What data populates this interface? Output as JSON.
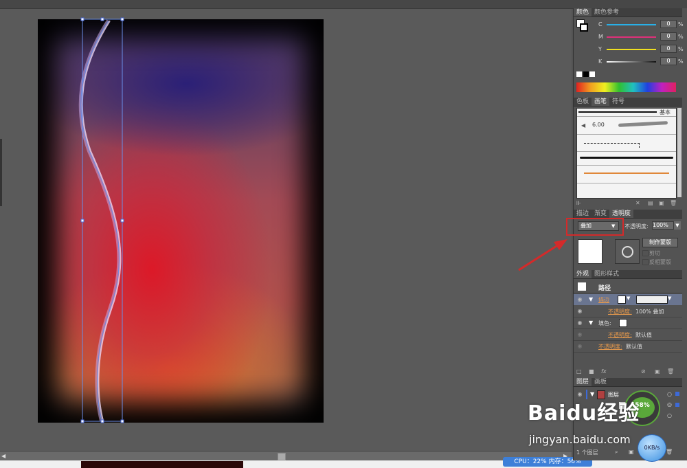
{
  "panels": {
    "color": {
      "tabs": [
        "颜色",
        "颜色参考"
      ],
      "channels": [
        {
          "letter": "C",
          "value": "0",
          "unit": "%",
          "color": "#28b0e8"
        },
        {
          "letter": "M",
          "value": "0",
          "unit": "%",
          "color": "#e0307a"
        },
        {
          "letter": "Y",
          "value": "0",
          "unit": "%",
          "color": "#f0e020"
        },
        {
          "letter": "K",
          "value": "0",
          "unit": "%",
          "color": "#222222"
        }
      ]
    },
    "brush": {
      "tabs": [
        "色板",
        "画笔",
        "符号"
      ],
      "basic_label": "基本",
      "size_value": "6.00"
    },
    "transparency": {
      "tabs": [
        "描边",
        "渐变",
        "透明度"
      ],
      "blend_mode": "叠加",
      "opacity_label": "不透明度:",
      "opacity_value": "100%",
      "make_mask_button": "制作蒙版",
      "clip_label": "剪切",
      "invert_mask_label": "反相蒙版"
    },
    "appearance": {
      "tabs": [
        "外观",
        "图形样式"
      ],
      "title": "路径",
      "rows": [
        {
          "label": "描边",
          "extra": ""
        },
        {
          "label": "不透明度:",
          "extra": "100% 叠加"
        },
        {
          "label": "填色:",
          "extra": ""
        },
        {
          "label": "不透明度:",
          "extra": "默认值"
        },
        {
          "label": "不透明度:",
          "extra": "默认值"
        }
      ]
    },
    "layers": {
      "tabs": [
        "图层",
        "画板"
      ],
      "layer_name": "图层",
      "count_label": "1 个图层"
    }
  },
  "overlays": {
    "gauge_percent": "58%",
    "speed": "0KB/s",
    "watermark_brand": "Baidu经验",
    "watermark_url": "jingyan.baidu.com"
  },
  "status": {
    "cpu_text": "CPU：22%  内存：56%"
  },
  "colors": {
    "accent_red": "#d42a2a",
    "selection_blue": "#6a8ee8",
    "panel_bg": "#535353"
  }
}
